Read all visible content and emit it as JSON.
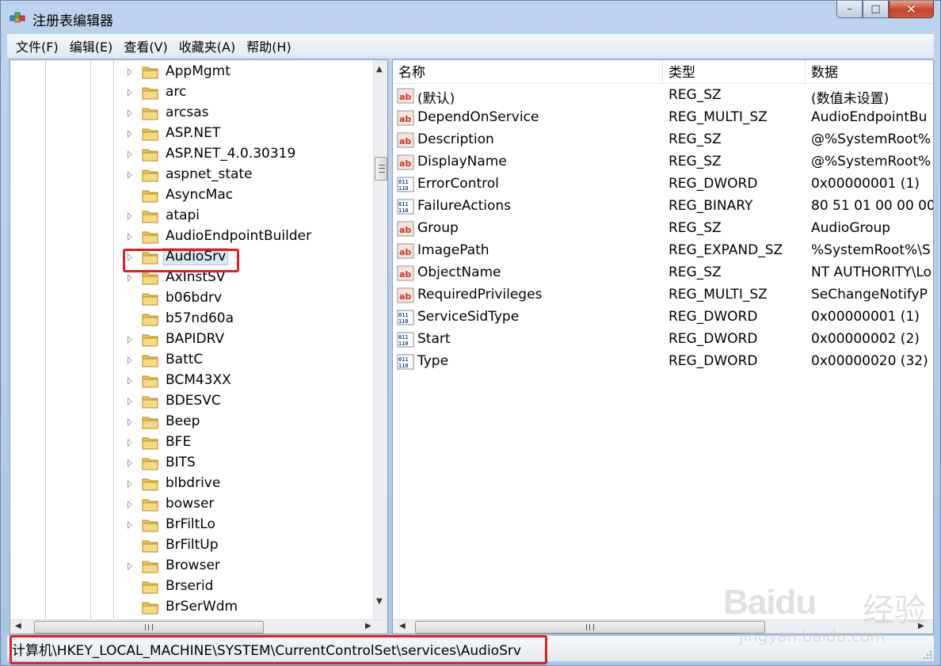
{
  "window": {
    "title": "注册表编辑器"
  },
  "menu": [
    "文件(F)",
    "编辑(E)",
    "查看(V)",
    "收藏夹(A)",
    "帮助(H)"
  ],
  "tree": {
    "items": [
      {
        "label": "AppMgmt",
        "expandable": true
      },
      {
        "label": "arc",
        "expandable": true
      },
      {
        "label": "arcsas",
        "expandable": true
      },
      {
        "label": "ASP.NET",
        "expandable": true
      },
      {
        "label": "ASP.NET_4.0.30319",
        "expandable": true
      },
      {
        "label": "aspnet_state",
        "expandable": true
      },
      {
        "label": "AsyncMac",
        "expandable": false
      },
      {
        "label": "atapi",
        "expandable": true
      },
      {
        "label": "AudioEndpointBuilder",
        "expandable": true
      },
      {
        "label": "AudioSrv",
        "expandable": true,
        "selected": true
      },
      {
        "label": "AxInstSV",
        "expandable": true
      },
      {
        "label": "b06bdrv",
        "expandable": false
      },
      {
        "label": "b57nd60a",
        "expandable": false
      },
      {
        "label": "BAPIDRV",
        "expandable": true
      },
      {
        "label": "BattC",
        "expandable": true
      },
      {
        "label": "BCM43XX",
        "expandable": true
      },
      {
        "label": "BDESVC",
        "expandable": true
      },
      {
        "label": "Beep",
        "expandable": true
      },
      {
        "label": "BFE",
        "expandable": true
      },
      {
        "label": "BITS",
        "expandable": true
      },
      {
        "label": "blbdrive",
        "expandable": true
      },
      {
        "label": "bowser",
        "expandable": true
      },
      {
        "label": "BrFiltLo",
        "expandable": true
      },
      {
        "label": "BrFiltUp",
        "expandable": false
      },
      {
        "label": "Browser",
        "expandable": true
      },
      {
        "label": "Brserid",
        "expandable": false
      },
      {
        "label": "BrSerWdm",
        "expandable": false
      }
    ]
  },
  "list": {
    "columns": {
      "name": "名称",
      "type": "类型",
      "data": "数据"
    },
    "rows": [
      {
        "icon": "string-value-icon",
        "name": "(默认)",
        "type": "REG_SZ",
        "data": "(数值未设置)"
      },
      {
        "icon": "string-value-icon",
        "name": "DependOnService",
        "type": "REG_MULTI_SZ",
        "data": "AudioEndpointBu"
      },
      {
        "icon": "string-value-icon",
        "name": "Description",
        "type": "REG_SZ",
        "data": "@%SystemRoot%"
      },
      {
        "icon": "string-value-icon",
        "name": "DisplayName",
        "type": "REG_SZ",
        "data": "@%SystemRoot%"
      },
      {
        "icon": "binary-value-icon",
        "name": "ErrorControl",
        "type": "REG_DWORD",
        "data": "0x00000001 (1)"
      },
      {
        "icon": "binary-value-icon",
        "name": "FailureActions",
        "type": "REG_BINARY",
        "data": "80 51 01 00 00 00"
      },
      {
        "icon": "string-value-icon",
        "name": "Group",
        "type": "REG_SZ",
        "data": "AudioGroup"
      },
      {
        "icon": "string-value-icon",
        "name": "ImagePath",
        "type": "REG_EXPAND_SZ",
        "data": "%SystemRoot%\\S"
      },
      {
        "icon": "string-value-icon",
        "name": "ObjectName",
        "type": "REG_SZ",
        "data": "NT AUTHORITY\\Lo"
      },
      {
        "icon": "string-value-icon",
        "name": "RequiredPrivileges",
        "type": "REG_MULTI_SZ",
        "data": "SeChangeNotifyP"
      },
      {
        "icon": "binary-value-icon",
        "name": "ServiceSidType",
        "type": "REG_DWORD",
        "data": "0x00000001 (1)"
      },
      {
        "icon": "binary-value-icon",
        "name": "Start",
        "type": "REG_DWORD",
        "data": "0x00000002 (2)"
      },
      {
        "icon": "binary-value-icon",
        "name": "Type",
        "type": "REG_DWORD",
        "data": "0x00000020 (32)"
      }
    ]
  },
  "status": {
    "path": "计算机\\HKEY_LOCAL_MACHINE\\SYSTEM\\CurrentControlSet\\services\\AudioSrv"
  },
  "watermark": {
    "logo": "Baidu",
    "suffix": "经验",
    "url": "jingyan.baidu.com"
  },
  "colors": {
    "highlight": "#e02020",
    "selection": "#dbe8f7",
    "titlebar": "#bcd3ee"
  }
}
